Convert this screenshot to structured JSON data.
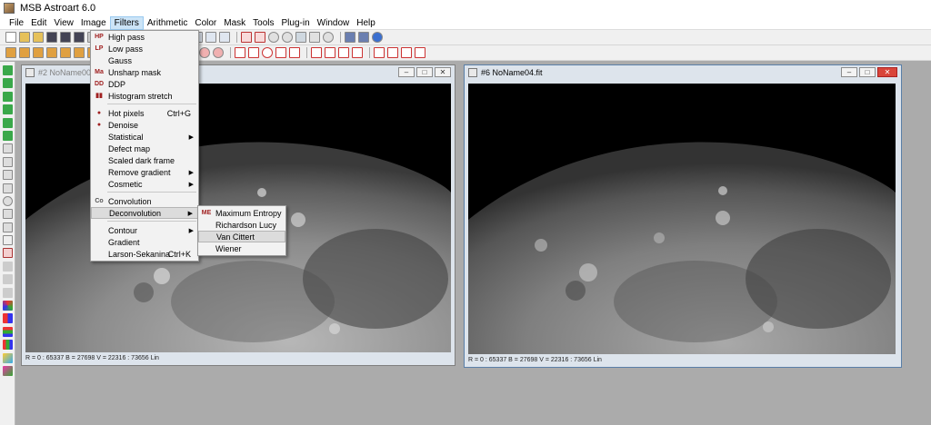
{
  "app": {
    "title": "MSB Astroart 6.0"
  },
  "menubar": [
    "File",
    "Edit",
    "View",
    "Image",
    "Filters",
    "Arithmetic",
    "Color",
    "Mask",
    "Tools",
    "Plug-in",
    "Window",
    "Help"
  ],
  "filters_menu": {
    "items": [
      {
        "icon": "HP",
        "label": "High pass",
        "shortcut": "",
        "submenu": false
      },
      {
        "icon": "LP",
        "label": "Low pass",
        "shortcut": "",
        "submenu": false
      },
      {
        "icon": "",
        "label": "Gauss",
        "shortcut": "",
        "submenu": false
      },
      {
        "icon": "Ma",
        "label": "Unsharp mask",
        "shortcut": "",
        "submenu": false
      },
      {
        "icon": "DD",
        "label": "DDP",
        "shortcut": "",
        "submenu": false
      },
      {
        "icon": "",
        "label": "Histogram stretch",
        "shortcut": "",
        "submenu": false
      },
      {
        "icon": "",
        "label": "Hot pixels",
        "shortcut": "Ctrl+G",
        "submenu": false
      },
      {
        "icon": "",
        "label": "Denoise",
        "shortcut": "",
        "submenu": false
      },
      {
        "icon": "",
        "label": "Statistical",
        "shortcut": "",
        "submenu": true
      },
      {
        "icon": "",
        "label": "Defect map",
        "shortcut": "",
        "submenu": false
      },
      {
        "icon": "",
        "label": "Scaled dark frame",
        "shortcut": "",
        "submenu": false
      },
      {
        "icon": "",
        "label": "Remove gradient",
        "shortcut": "",
        "submenu": true
      },
      {
        "icon": "",
        "label": "Cosmetic",
        "shortcut": "",
        "submenu": true
      },
      {
        "icon": "Co",
        "label": "Convolution",
        "shortcut": "",
        "submenu": false
      },
      {
        "icon": "",
        "label": "Deconvolution",
        "shortcut": "",
        "submenu": true
      },
      {
        "icon": "",
        "label": "Contour",
        "shortcut": "",
        "submenu": true
      },
      {
        "icon": "",
        "label": "Gradient",
        "shortcut": "",
        "submenu": false
      },
      {
        "icon": "",
        "label": "Larson-Sekanina",
        "shortcut": "Ctrl+K",
        "submenu": false
      }
    ]
  },
  "deconvolution_submenu": {
    "items": [
      {
        "icon": "ME",
        "label": "Maximum Entropy"
      },
      {
        "icon": "",
        "label": "Richardson Lucy"
      },
      {
        "icon": "",
        "label": "Van Cittert"
      },
      {
        "icon": "",
        "label": "Wiener"
      }
    ]
  },
  "windows": [
    {
      "title": "#2 NoName00.fit",
      "status": "R = 0 : 65337    B = 27698    V = 22316 : 73656 Lin",
      "active": false
    },
    {
      "title": "#6 NoName04.fit",
      "status": "R = 0 : 65337    B = 27698    V = 22316 : 73656 Lin",
      "active": true
    }
  ],
  "colors": {
    "accent_red": "#a02020",
    "highlight": "#dcdcdc",
    "close_red": "#d9453a"
  }
}
